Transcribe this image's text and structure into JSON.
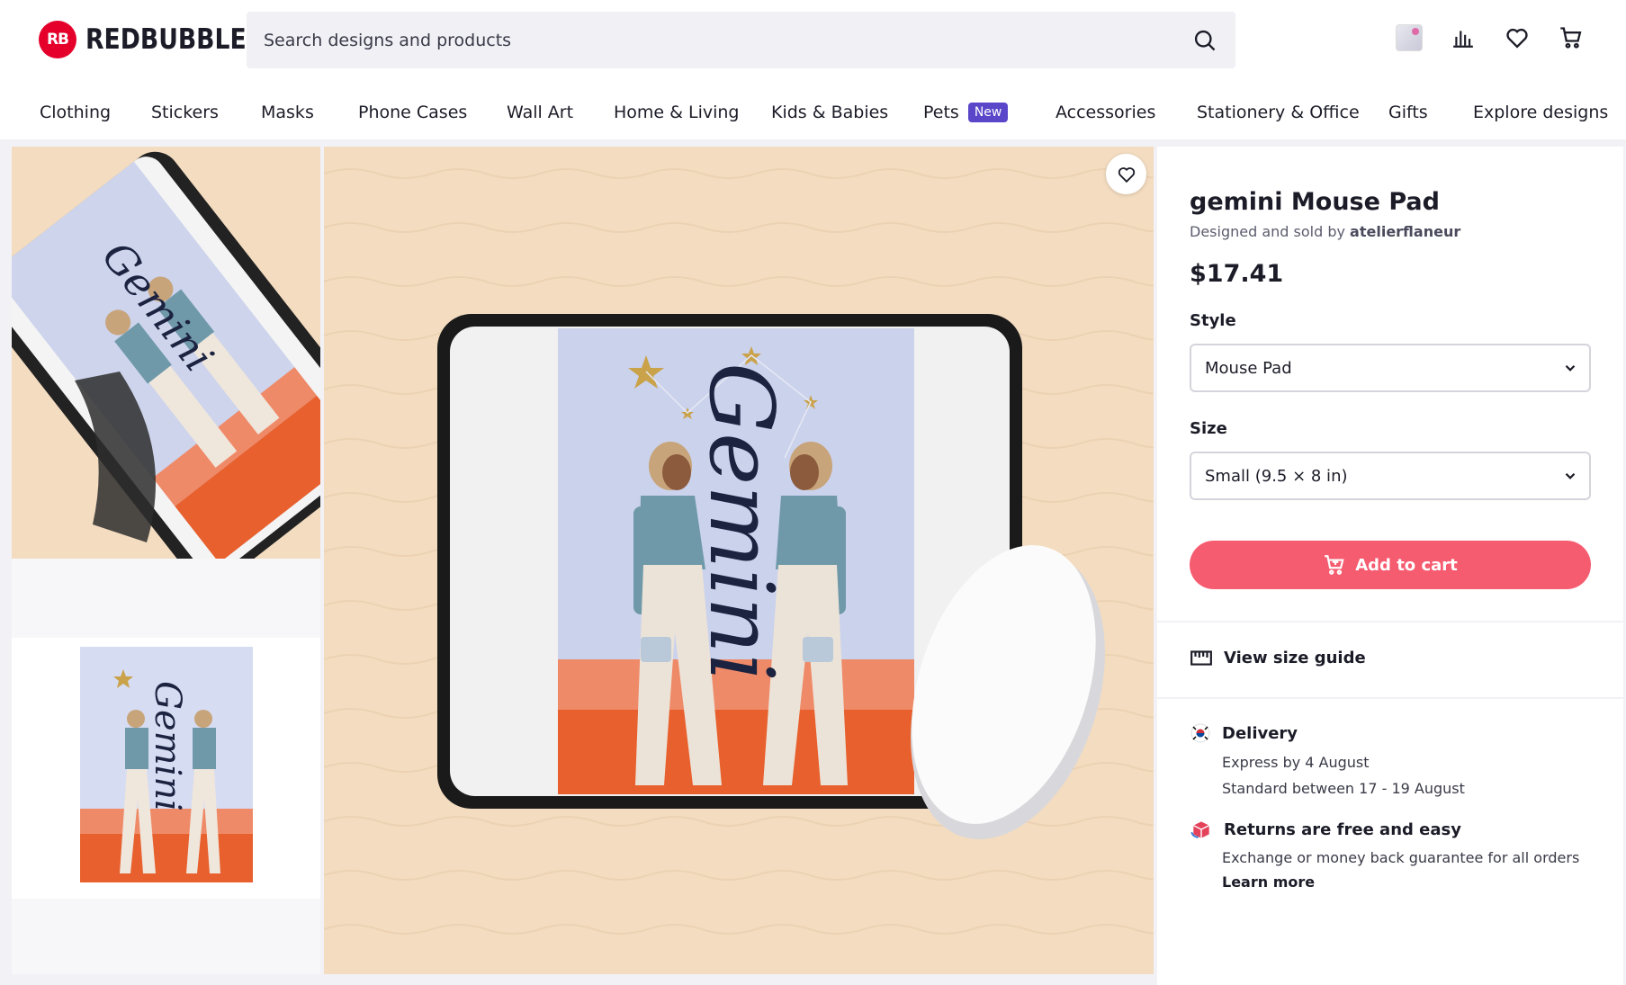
{
  "header": {
    "logo_mark": "RB",
    "logo_text": "REDBUBBLE",
    "search_placeholder": "Search designs and products",
    "icons": [
      "search-icon",
      "avatar",
      "stats-icon",
      "heart-icon",
      "cart-icon"
    ]
  },
  "nav": {
    "items": [
      "Clothing",
      "Stickers",
      "Masks",
      "Phone Cases",
      "Wall Art",
      "Home & Living",
      "Kids & Babies",
      "Pets",
      "Accessories",
      "Stationery & Office",
      "Gifts",
      "Explore designs"
    ],
    "pets_badge": "New"
  },
  "gallery": {
    "artwork_word": "Gemini"
  },
  "product": {
    "title": "gemini Mouse Pad",
    "byline_prefix": "Designed and sold by",
    "artist": "atelierflaneur",
    "price": "$17.41",
    "style_label": "Style",
    "style_value": "Mouse Pad",
    "size_label": "Size",
    "size_value": "Small (9.5 × 8 in)",
    "add_to_cart": "Add to cart",
    "size_guide": "View size guide",
    "delivery_title": "Delivery",
    "delivery_express": "Express by 4 August",
    "delivery_standard": "Standard between 17 - 19 August",
    "returns_title": "Returns are free and easy",
    "returns_text": "Exchange or money back guarantee for all orders",
    "learn_more": "Learn more"
  },
  "colors": {
    "brand_red": "#e4002b",
    "cart_button": "#f65c70",
    "new_badge": "#5a46c9",
    "wood": "#f3dcc0"
  }
}
